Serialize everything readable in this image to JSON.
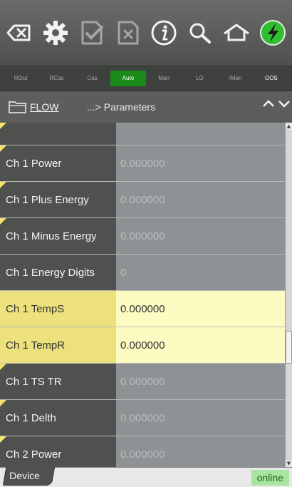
{
  "toolbar": {
    "icons": [
      "backspace-icon",
      "gear-icon",
      "checkmark-document-icon",
      "cancel-document-icon",
      "info-icon",
      "search-icon",
      "home-icon",
      "lightning-icon"
    ]
  },
  "modes": {
    "rout": "ROut",
    "rcas": "RCas",
    "cas": "Cas",
    "auto": "Auto",
    "man": "Man",
    "lo": "LO",
    "iman": "IMan",
    "oos": "OOS",
    "active": "Auto",
    "active_color": "#1a8a1a"
  },
  "breadcrumb": {
    "folder": "FLOW",
    "separator": "...> Parameters"
  },
  "parameters": [
    {
      "name": "",
      "value": ""
    },
    {
      "name": "Ch 1 Power",
      "value": "0.000000"
    },
    {
      "name": "Ch 1 Plus Energy",
      "value": "0.000000"
    },
    {
      "name": "Ch 1 Minus Energy",
      "value": "0.000000"
    },
    {
      "name": "Ch 1 Energy Digits",
      "value": "0"
    },
    {
      "name": "Ch 1 TempS",
      "value": "0.000000"
    },
    {
      "name": "Ch 1 TempR",
      "value": "0.000000"
    },
    {
      "name": "Ch 1 TS TR",
      "value": "0.000000"
    },
    {
      "name": "Ch 1 Delth",
      "value": "0.000000"
    },
    {
      "name": "Ch 2 Power",
      "value": "0.000000"
    },
    {
      "name": "",
      "value": ""
    }
  ],
  "footer": {
    "tab": "Device",
    "status": "online",
    "status_color": "#a9e5a0"
  }
}
